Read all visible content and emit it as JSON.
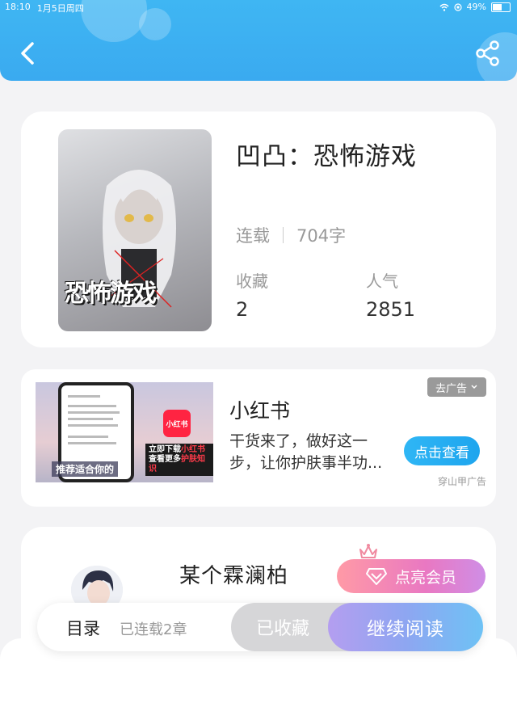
{
  "status_bar": {
    "time": "18:10",
    "date": "1月5日周四",
    "battery": "49%",
    "battery_level": 0.49
  },
  "header": {
    "back_icon": "chevron-left-icon",
    "share_icon": "share-icon",
    "color": "#3db2f2"
  },
  "book": {
    "cover_title": "恐怖游戏",
    "title": "凹凸：恐怖游戏",
    "status": "连载",
    "word_count": "704字",
    "favorites_label": "收藏",
    "favorites_value": "2",
    "popularity_label": "人气",
    "popularity_value": "2851"
  },
  "ad": {
    "remove_label": "去广告",
    "title": "小红书",
    "description": "干货来了，做好这一步，让你护肤事半功...",
    "cta_label": "点击查看",
    "source": "穿山甲广告",
    "image_logo": "小红书",
    "image_text_1": "立即下载",
    "image_text_1_hl": "小红书",
    "image_text_2": "查看更多",
    "image_text_2_hl": "护肤知识",
    "image_caption": "推荐适合你的",
    "accent": "#ff2442"
  },
  "author": {
    "name": "某个霖澜柏",
    "vip_label": "点亮会员"
  },
  "bottom_bar": {
    "toc_label": "目录",
    "chapters": "已连载2章",
    "collected_label": "已收藏",
    "read_label": "继续阅读"
  }
}
